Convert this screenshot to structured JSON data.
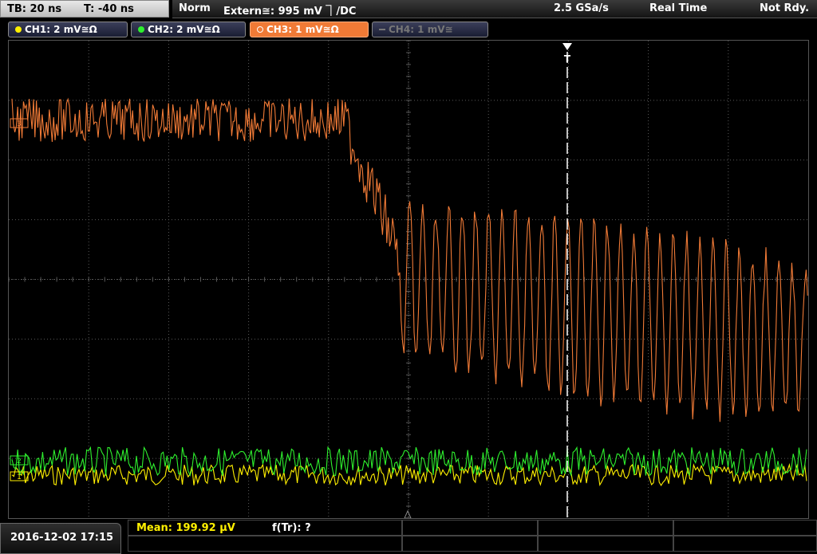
{
  "status": {
    "timebase": "TB: 20 ns",
    "trigger_time": "T: -40 ns",
    "mode": "Norm",
    "trigger_source": "Extern≅: 995 mV ⏋/DC",
    "sample_rate": "2.5 GSa/s",
    "acq_mode": "Real Time",
    "state": "Not Rdy."
  },
  "channels": [
    {
      "label": "CH1: 2 mV≅Ω",
      "color": "#fff000",
      "active": true
    },
    {
      "label": "CH2: 2 mV≅Ω",
      "color": "#2ef02e",
      "active": true
    },
    {
      "label": "CH3: 1 mV≅Ω",
      "color": "#f07a36",
      "active": true,
      "selected": true
    },
    {
      "label": "CH4: 1 mV≅",
      "color": "#777777",
      "active": false
    }
  ],
  "markers": {
    "trigger_label": "T",
    "ch3_marker": "3",
    "ch2_marker": "2",
    "ch1_marker": "1"
  },
  "measurements": {
    "mean": "Mean: 199.92 µV",
    "rise_freq": "f(Tr): ?"
  },
  "datetime": "2016-12-02 17:15",
  "colors": {
    "ch1": "#fff000",
    "ch2": "#2ef02e",
    "ch3": "#f07a36",
    "grid": "#5a5a5a",
    "trigger_line": "#ffffff"
  }
}
